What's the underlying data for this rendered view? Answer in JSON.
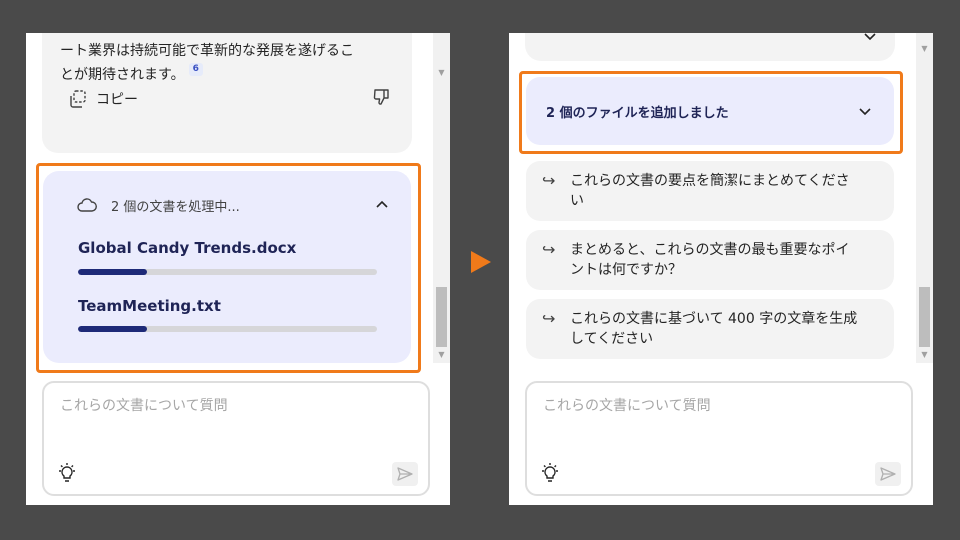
{
  "colors": {
    "background": "#4a4a4a",
    "panel": "#ffffff",
    "highlight": "#f07a1a",
    "card_lavender": "#ebecfd",
    "progress_fill": "#1e2a78"
  },
  "left": {
    "answer": {
      "line1": "ート業界は持続可能で革新的な発展を遂げるこ",
      "line2": "とが期待されます。",
      "citation": "6",
      "copy_label": "コピー",
      "copy_icon": "copy-icon",
      "dislike_icon": "thumbs-down-icon"
    },
    "processing": {
      "icon": "cloud-icon",
      "title": "2 個の文書を処理中...",
      "files": [
        {
          "name": "Global Candy Trends.docx",
          "progress": 0.23
        },
        {
          "name": "TeamMeeting.txt",
          "progress": 0.23
        }
      ]
    },
    "input": {
      "placeholder": "これらの文書について質問"
    }
  },
  "right": {
    "added_files_label": "2 個のファイルを追加しました",
    "suggestions": [
      {
        "line1": "これらの文書の要点を簡潔にまとめてくださ",
        "line2": "い"
      },
      {
        "line1": "まとめると、これらの文書の最も重要なポイ",
        "line2": "ントは何ですか？"
      },
      {
        "line1": "これらの文書に基づいて 400 字の文章を生成",
        "line2": "してください"
      }
    ],
    "input": {
      "placeholder": "これらの文書について質問"
    }
  }
}
